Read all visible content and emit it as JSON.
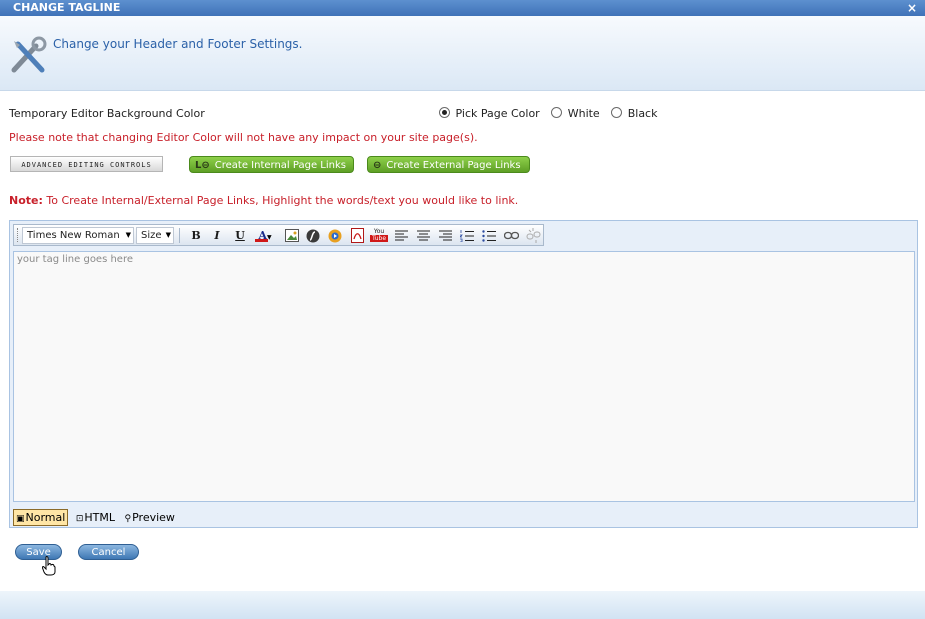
{
  "window": {
    "title": "CHANGE TAGLINE",
    "close_glyph": "×"
  },
  "header": {
    "icon": "tools-icon",
    "text": "Change your Header and Footer Settings."
  },
  "background": {
    "label": "Temporary Editor Background Color",
    "options": [
      "Pick Page Color",
      "White",
      "Black"
    ],
    "selected": "Pick Page Color",
    "warning": "Please note that changing Editor Color will not have any impact on your site page(s)."
  },
  "buttons": {
    "advanced": "ADVANCED EDITING CONTROLS",
    "internal_links": "Create Internal Page Links",
    "external_links": "Create External Page Links",
    "save": "Save",
    "cancel": "Cancel"
  },
  "note": {
    "prefix": "Note:",
    "text": "To Create Internal/External Page Links, Highlight the words/text you would like to link."
  },
  "editor": {
    "font": "Times New Roman",
    "size": "Size",
    "placeholder": "your tag line goes here",
    "toolbar_icons": [
      "bold-icon",
      "italic-icon",
      "underline-icon",
      "font-color-icon",
      "image-icon",
      "flash-icon",
      "media-icon",
      "pdf-icon",
      "youtube-icon",
      "align-left-icon",
      "align-center-icon",
      "align-right-icon",
      "ordered-list-icon",
      "unordered-list-icon",
      "link-icon",
      "unlink-icon"
    ],
    "modes": [
      "Normal",
      "HTML",
      "Preview"
    ],
    "active_mode": "Normal"
  },
  "colors": {
    "title_bar": "#3f72b8",
    "warning": "#c8202a",
    "header_text": "#2b61a8",
    "green_button": "#6fb032"
  }
}
